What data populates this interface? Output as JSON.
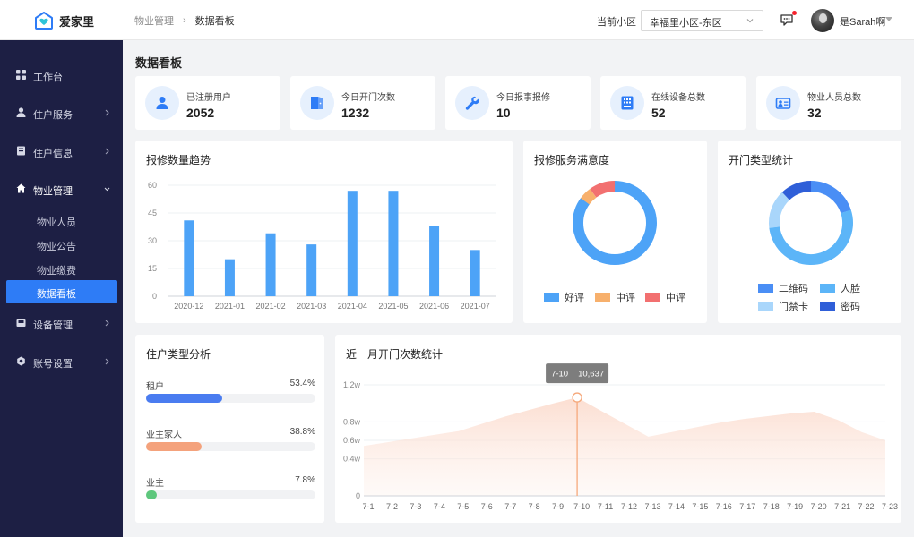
{
  "app": {
    "name": "爱家里"
  },
  "breadcrumb": {
    "parent": "物业管理",
    "current": "数据看板"
  },
  "header": {
    "community_label": "当前小区",
    "community_value": "幸福里小区-东区",
    "user_name": "是Sarah啊"
  },
  "sidebar": {
    "items": [
      {
        "label": "工作台",
        "icon": "grid-icon"
      },
      {
        "label": "住户服务",
        "icon": "user-icon"
      },
      {
        "label": "住户信息",
        "icon": "book-icon"
      },
      {
        "label": "物业管理",
        "icon": "home-icon"
      },
      {
        "label": "设备管理",
        "icon": "device-icon"
      },
      {
        "label": "账号设置",
        "icon": "gear-icon"
      }
    ],
    "sub_items": [
      {
        "label": "物业人员"
      },
      {
        "label": "物业公告"
      },
      {
        "label": "物业缴费"
      },
      {
        "label": "数据看板"
      }
    ]
  },
  "page": {
    "title": "数据看板"
  },
  "stats": [
    {
      "label": "已注册用户",
      "value": "2052",
      "icon": "user-icon"
    },
    {
      "label": "今日开门次数",
      "value": "1232",
      "icon": "door-icon"
    },
    {
      "label": "今日报事报修",
      "value": "10",
      "icon": "wrench-icon"
    },
    {
      "label": "在线设备总数",
      "value": "52",
      "icon": "device-icon"
    },
    {
      "label": "物业人员总数",
      "value": "32",
      "icon": "staff-card-icon"
    }
  ],
  "repair_chart": {
    "title": "报修数量趋势"
  },
  "satisfaction": {
    "title": "报修服务满意度"
  },
  "door_types": {
    "title": "开门类型统计"
  },
  "resident_types": {
    "title": "住户类型分析",
    "rows": [
      {
        "name": "租户",
        "pct_label": "53.4%",
        "pct": 53.4,
        "color": "#4a7cf0"
      },
      {
        "name": "业主家人",
        "pct_label": "38.8%",
        "pct": 38.8,
        "color": "#f4a27c"
      },
      {
        "name": "业主",
        "pct_label": "7.8%",
        "pct": 7.8,
        "color": "#5ec77d"
      }
    ]
  },
  "monthly_chart": {
    "title": "近一月开门次数统计"
  },
  "chart_data": [
    {
      "type": "bar",
      "title": "报修数量趋势",
      "categories": [
        "2020-12",
        "2021-01",
        "2021-02",
        "2021-03",
        "2021-04",
        "2021-05",
        "2021-06",
        "2021-07"
      ],
      "values": [
        41,
        20,
        34,
        28,
        57,
        57,
        38,
        25
      ],
      "yticks": [
        "0",
        "15",
        "30",
        "45",
        "60"
      ],
      "ylim": [
        0,
        60
      ],
      "grid": true,
      "color": "#4da3f7"
    },
    {
      "type": "pie",
      "title": "报修服务满意度",
      "labels": [
        "好评",
        "中评",
        "中评"
      ],
      "values": [
        85,
        5,
        10
      ],
      "colors": [
        "#4da3f7",
        "#f7b06c",
        "#f27070"
      ],
      "legend": "bottom"
    },
    {
      "type": "pie",
      "title": "开门类型统计",
      "labels": [
        "二维码",
        "人脸",
        "门禁卡",
        "密码"
      ],
      "values": [
        20,
        53,
        15,
        12
      ],
      "colors": [
        "#4a8ef5",
        "#5cb5f8",
        "#a9d6fb",
        "#2f5fd8"
      ],
      "legend": "bottom"
    },
    {
      "type": "area",
      "title": "近一月开门次数统计",
      "x": [
        "7-1",
        "7-2",
        "7-3",
        "7-4",
        "7-5",
        "7-6",
        "7-7",
        "7-8",
        "7-9",
        "7-10",
        "7-11",
        "7-12",
        "7-13",
        "7-14",
        "7-15",
        "7-16",
        "7-17",
        "7-18",
        "7-19",
        "7-20",
        "7-21",
        "7-22",
        "7-23"
      ],
      "values": [
        5400,
        5800,
        6200,
        6600,
        7000,
        7800,
        8600,
        9300,
        10000,
        10637,
        9200,
        7800,
        6400,
        6900,
        7400,
        7900,
        8300,
        8600,
        8900,
        9100,
        8200,
        6900,
        6000
      ],
      "yticks": [
        "0",
        "0.4w",
        "0.6w",
        "0.8w",
        "1.2w"
      ],
      "ytick_values": [
        0,
        4000,
        6000,
        8000,
        12000
      ],
      "ylim": [
        0,
        12000
      ],
      "tooltip": {
        "x": "7-10",
        "value": "10,637"
      },
      "grid": true
    }
  ]
}
